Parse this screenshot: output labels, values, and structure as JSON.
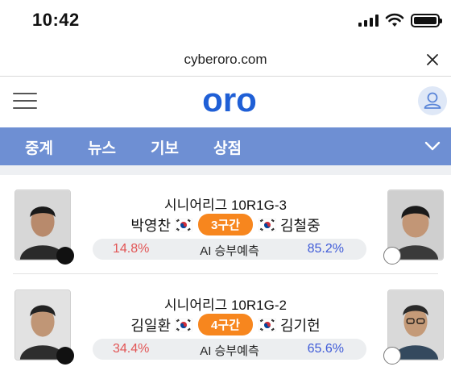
{
  "status": {
    "time": "10:42"
  },
  "browser": {
    "url": "cyberoro.com"
  },
  "header": {
    "logo": "oro"
  },
  "nav": {
    "items": [
      "중계",
      "뉴스",
      "기보",
      "상점"
    ]
  },
  "games": [
    {
      "league": "시니어리그 10R1G-3",
      "black_player": "박영찬",
      "white_player": "김철중",
      "status": "3구간",
      "left_pct": "14.8%",
      "ai_label": "AI 승부예측",
      "right_pct": "85.2%"
    },
    {
      "league": "시니어리그 10R1G-2",
      "black_player": "김일환",
      "white_player": "김기헌",
      "status": "4구간",
      "left_pct": "34.4%",
      "ai_label": "AI 승부예측",
      "right_pct": "65.6%"
    }
  ],
  "colors": {
    "nav": "#6e8fd3",
    "logo": "#1f5fd6",
    "badge": "#f7861e",
    "left_pct": "#e25555",
    "right_pct": "#3f5bd8"
  },
  "icons": [
    "wifi-icon",
    "battery-icon",
    "close-icon",
    "menu-icon",
    "user-icon",
    "chevron-down-icon",
    "korea-flag-icon"
  ]
}
